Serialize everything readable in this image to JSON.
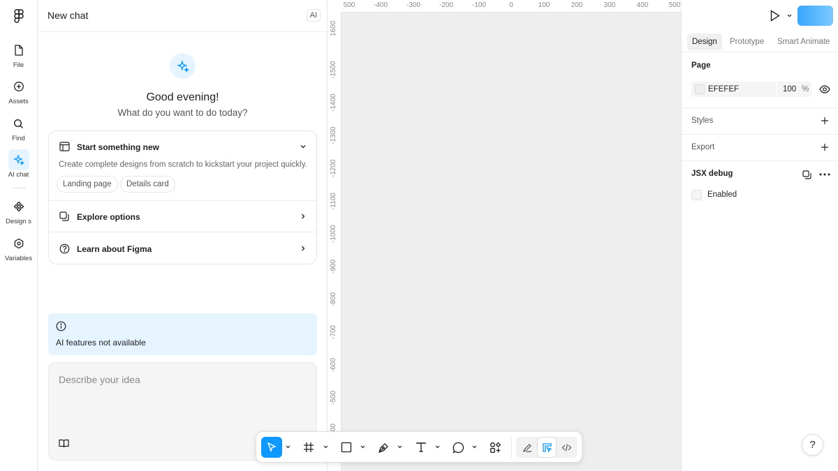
{
  "rail": {
    "items": [
      {
        "label": "File",
        "icon": "file-icon"
      },
      {
        "label": "Assets",
        "icon": "assets-icon"
      },
      {
        "label": "Find",
        "icon": "search-icon"
      },
      {
        "label": "AI chat",
        "icon": "sparkle-icon",
        "active": true
      },
      {
        "label": "Design s",
        "icon": "design-system-icon"
      },
      {
        "label": "Variables",
        "icon": "variables-icon"
      }
    ]
  },
  "chat": {
    "title": "New chat",
    "badge": "AI",
    "greeting": "Good evening!",
    "subtitle": "What do you want to do today?",
    "options": {
      "start": {
        "label": "Start something new",
        "description": "Create complete designs from scratch to kickstart your project quickly.",
        "chips": [
          "Landing page",
          "Details card"
        ]
      },
      "explore": {
        "label": "Explore options"
      },
      "learn": {
        "label": "Learn about Figma"
      }
    },
    "notice": "AI features not available",
    "prompt_placeholder": "Describe your idea"
  },
  "canvas": {
    "ruler_x": [
      "500",
      "-400",
      "-300",
      "-200",
      "-100",
      "0",
      "100",
      "200",
      "300",
      "400",
      "500"
    ],
    "ruler_y": [
      "1600",
      "-1500",
      "-1400",
      "-1300",
      "-1200",
      "-1100",
      "-1000",
      "-900",
      "-800",
      "-700",
      "-600",
      "-500",
      "-400"
    ],
    "background": "#eeeeee"
  },
  "toolbar": {
    "tools": [
      "move-tool",
      "frame-tool",
      "rectangle-tool",
      "pen-tool",
      "text-tool",
      "comment-tool",
      "actions-tool"
    ],
    "modes": [
      "draw-mode",
      "design-mode",
      "dev-mode"
    ],
    "accent": "#0d99ff"
  },
  "props": {
    "tabs": [
      "Design",
      "Prototype",
      "Smart Animate"
    ],
    "active_tab": "Design",
    "page": {
      "title": "Page",
      "color_hex": "EFEFEF",
      "opacity": "100",
      "unit": "%"
    },
    "styles": "Styles",
    "export": "Export",
    "jsx": {
      "title": "JSX debug",
      "enabled_label": "Enabled"
    },
    "help": "?"
  }
}
